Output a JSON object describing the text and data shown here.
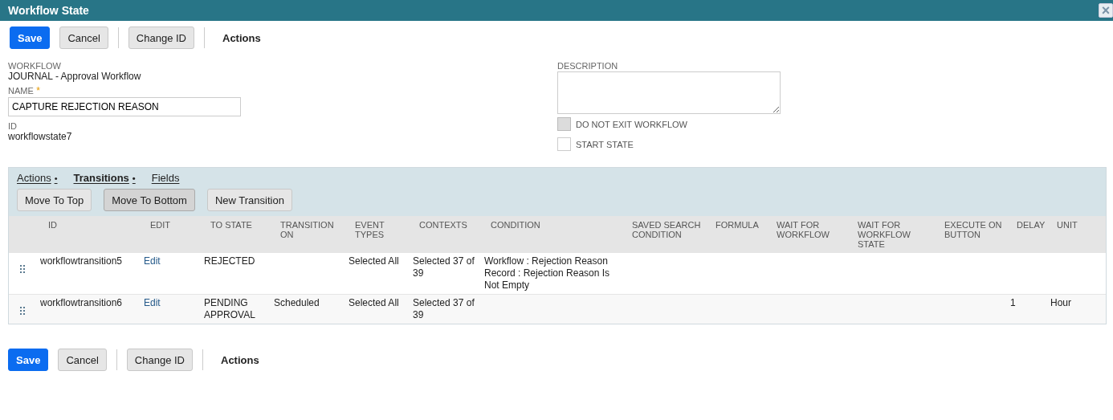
{
  "window": {
    "title": "Workflow State",
    "close": "×"
  },
  "toolbar_top": {
    "buttons": [
      {
        "label": "Save",
        "kind": "primary"
      },
      {
        "label": "Cancel",
        "kind": "secondary"
      },
      {
        "label": "Change ID",
        "kind": "secondary"
      }
    ],
    "menu": "Actions"
  },
  "form": {
    "workflow": {
      "label": "WORKFLOW",
      "value": "JOURNAL - Approval Workflow"
    },
    "name": {
      "label": "NAME",
      "required": "*",
      "value": "CAPTURE REJECTION REASON"
    },
    "id": {
      "label": "ID",
      "value": "workflowstate7"
    },
    "description": {
      "label": "DESCRIPTION"
    },
    "checkboxes": [
      {
        "label": "DO NOT EXIT WORKFLOW",
        "checked": false,
        "disabled": true
      },
      {
        "label": "START STATE",
        "checked": false,
        "disabled": false
      }
    ]
  },
  "subtabs": [
    {
      "label": "Actions",
      "dot": "•",
      "selected": false
    },
    {
      "label": "Transitions",
      "dot": "•",
      "selected": true
    },
    {
      "label": "Fields",
      "selected": false
    }
  ],
  "sublist_buttons": [
    {
      "label": "Move To Top",
      "pressed": false
    },
    {
      "label": "Move To Bottom",
      "pressed": true
    },
    {
      "label": "New Transition",
      "pressed": false
    }
  ],
  "table": {
    "columns": [
      "ID",
      "EDIT",
      "TO STATE",
      "TRANSITION ON",
      "EVENT TYPES",
      "CONTEXTS",
      "CONDITION",
      "SAVED SEARCH CONDITION",
      "FORMULA",
      "WAIT FOR WORKFLOW",
      "WAIT FOR WORKFLOW STATE",
      "EXECUTE ON BUTTON",
      "DELAY",
      "UNIT"
    ],
    "rows": [
      {
        "id": "workflowtransition5",
        "edit": "Edit",
        "to_state": "REJECTED",
        "transition_on": "",
        "event_types": "Selected All",
        "contexts": "Selected 37 of 39",
        "condition": "Workflow : Rejection Reason Record : Rejection Reason Is Not Empty",
        "delay": "",
        "unit": ""
      },
      {
        "id": "workflowtransition6",
        "edit": "Edit",
        "to_state": "PENDING APPROVAL",
        "transition_on": "Scheduled",
        "event_types": "Selected All",
        "contexts": "Selected 37 of 39",
        "condition": "",
        "delay": "1",
        "unit": "Hour"
      }
    ]
  },
  "toolbar_bottom": {
    "buttons": [
      {
        "label": "Save",
        "kind": "primary"
      },
      {
        "label": "Cancel",
        "kind": "secondary"
      },
      {
        "label": "Change ID",
        "kind": "secondary"
      }
    ],
    "menu": "Actions"
  }
}
